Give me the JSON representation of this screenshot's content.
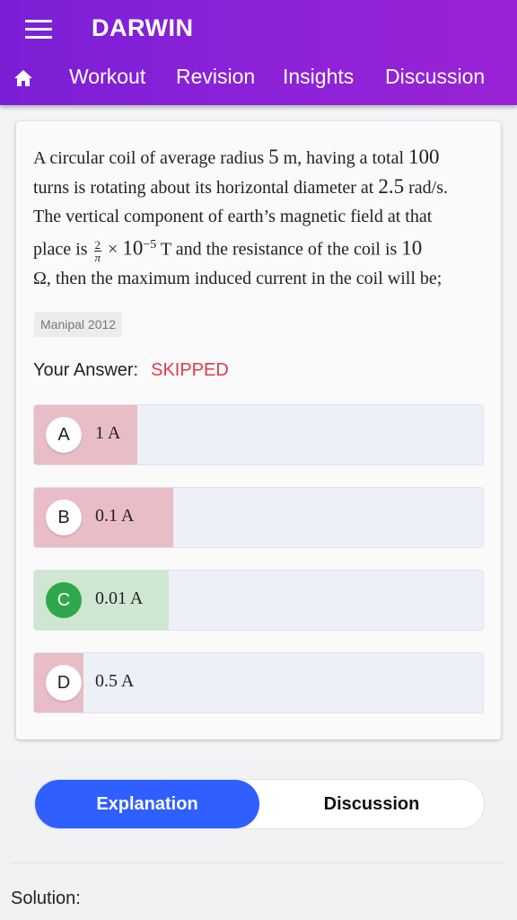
{
  "app": {
    "title": "DARWIN"
  },
  "nav": {
    "items": [
      "Workout",
      "Revision",
      "Insights",
      "Discussion"
    ]
  },
  "question": {
    "line1_a": "A circular coil of average radius ",
    "radius": "5",
    "line1_b": " m, having a total ",
    "turns": "100",
    "line2_a": "turns is rotating about its horizontal diameter at ",
    "omega": "2.5",
    "line2_b": " rad/s.",
    "line3": "The vertical component of earth’s magnetic field at that",
    "line4_a": "place is ",
    "frac_num": "2",
    "frac_den": "π",
    "times": " × ",
    "ten": "10",
    "exp": "−5",
    "line4_b": " T and the resistance of the coil is ",
    "resistance": "10",
    "line5": "Ω, then the maximum induced current in the coil will be;",
    "tag": "Manipal 2012"
  },
  "your_answer": {
    "label": "Your Answer:",
    "value": "SKIPPED"
  },
  "options": [
    {
      "letter": "A",
      "text": "1 A",
      "percent": 23,
      "fill_color": "#e9bdc6",
      "correct": false
    },
    {
      "letter": "B",
      "text": "0.1 A",
      "percent": 31,
      "fill_color": "#e9bdc6",
      "correct": false
    },
    {
      "letter": "C",
      "text": "0.01 A",
      "percent": 30,
      "fill_color": "#cfe6d3",
      "correct": true
    },
    {
      "letter": "D",
      "text": "0.5 A",
      "percent": 11,
      "fill_color": "#e9bdc6",
      "correct": false
    }
  ],
  "tabs": {
    "explanation": "Explanation",
    "discussion": "Discussion"
  },
  "solution": {
    "label": "Solution:"
  },
  "colors": {
    "appbar": "#8a22d8",
    "accent": "#2f5fff",
    "skipped": "#e03a4a",
    "correct": "#2ea84a"
  }
}
